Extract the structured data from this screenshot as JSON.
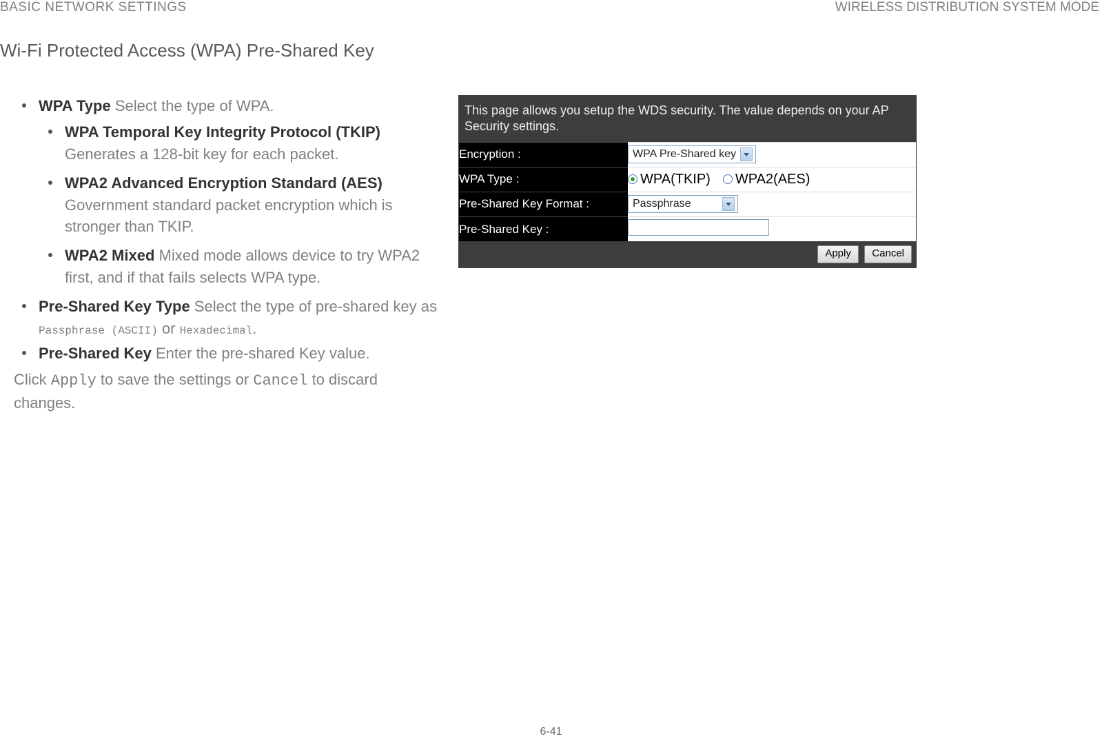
{
  "header": {
    "left": "BASIC NETWORK SETTINGS",
    "right": "WIRELESS DISTRIBUTION SYSTEM MODE"
  },
  "section_title": "Wi-Fi Protected Access (WPA) Pre-Shared Key",
  "bullets": {
    "wpa_type_label": "WPA Type",
    "wpa_type_desc": "  Select the type of WPA.",
    "tkip_label": "WPA Temporal Key Integrity Protocol (TKIP)",
    "tkip_desc": "  Generates a 128-bit key for each packet.",
    "aes_label": "WPA2 Advanced Encryption Standard (AES)",
    "aes_desc": "  Government standard packet encryption which is stronger than TKIP.",
    "mixed_label": "WPA2 Mixed",
    "mixed_desc": "  Mixed mode allows device to try WPA2 first, and if that fails selects WPA type.",
    "psk_type_label": "Pre-Shared Key Type",
    "psk_type_desc_1": "  Select the type of pre-shared key as ",
    "psk_type_mono_1": "Passphrase (ASCII)",
    "psk_type_desc_2": " or ",
    "psk_type_mono_2": "Hexadecimal",
    "psk_type_desc_3": ".",
    "psk_label": "Pre-Shared Key",
    "psk_desc": "  Enter the pre-shared Key value."
  },
  "closing": {
    "pre": "Click ",
    "apply": "Apply",
    "mid": " to save the settings or ",
    "cancel": "Cancel",
    "post": " to discard changes."
  },
  "panel": {
    "intro": "This page allows you setup the WDS security. The value depends on your AP Security settings.",
    "rows": {
      "encryption_label": "Encryption :",
      "encryption_value": "WPA Pre-Shared key",
      "wpa_type_label": "WPA Type :",
      "radio_tkip": "WPA(TKIP)",
      "radio_aes": "WPA2(AES)",
      "psk_format_label": "Pre-Shared Key Format :",
      "psk_format_value": "Passphrase",
      "psk_label": "Pre-Shared Key :",
      "psk_value": ""
    },
    "buttons": {
      "apply": "Apply",
      "cancel": "Cancel"
    }
  },
  "page_number": "6-41"
}
